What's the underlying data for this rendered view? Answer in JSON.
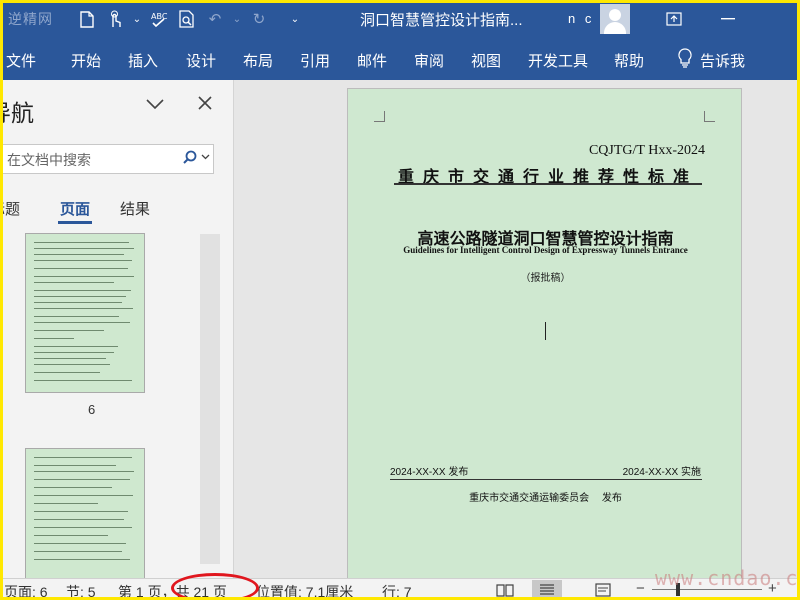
{
  "titlebar": {
    "watermark_logo": "逆精网",
    "doc_title": "洞口智慧管控设计指南...",
    "user_initials": "n c",
    "qat_icons": [
      "new-doc-icon",
      "touch-mode-icon",
      "spelling-icon",
      "print-preview-icon",
      "undo-icon",
      "redo-icon",
      "customize-icon"
    ],
    "window_icons": [
      "ribbon-display-icon",
      "minimize-icon"
    ]
  },
  "ribbon": {
    "tabs": [
      "文件",
      "开始",
      "插入",
      "设计",
      "布局",
      "引用",
      "邮件",
      "审阅",
      "视图",
      "开发工具",
      "帮助"
    ],
    "tell_me": "告诉我"
  },
  "nav": {
    "title": "导航",
    "search_placeholder": "在文档中搜索",
    "tabs": [
      "标题",
      "页面",
      "结果"
    ],
    "active_tab": "页面",
    "thumb_page_label": "6"
  },
  "document": {
    "std_code": "CQJTG/T Hxx-2024",
    "std_type": "重庆市交通行业推荐性标准",
    "main_title": "高速公路隧道洞口智慧管控设计指南",
    "sub_title": "Guidelines for Intelligent Control Design of Expressway Tunnels Entrance",
    "draft_label": "（报批稿）",
    "pub_date": "2024-XX-XX 发布",
    "impl_date": "2024-XX-XX 实施",
    "publisher": "重庆市交通交通运输委员会　 发布"
  },
  "statusbar": {
    "page": "页面: 6",
    "section": "节: 5",
    "page_of": "第 1 页，共 21 页",
    "position": "位置值: 7.1厘米",
    "line": "行: 7"
  },
  "watermark_site": "www.cndao.com",
  "colors": {
    "ribbon_blue": "#2b579a",
    "page_green": "#cfe8d0",
    "annotation_red": "#e0161e",
    "frame_yellow": "#ffe800"
  }
}
